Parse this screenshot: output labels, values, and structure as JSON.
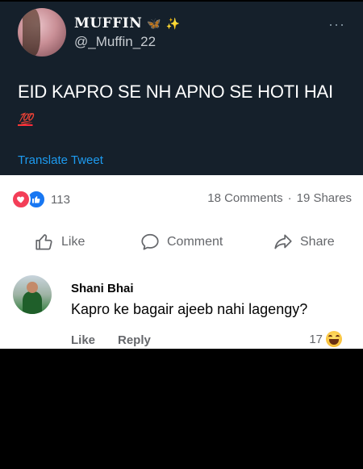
{
  "tweet": {
    "display_name": "MUFFIN",
    "name_emojis": [
      "🦋",
      "✨"
    ],
    "handle": "@_Muffin_22",
    "text": "EID KAPRO SE NH APNO SE HOTI HAI",
    "text_emoji": "💯",
    "translate_label": "Translate Tweet",
    "more_icon": "more-dots-icon"
  },
  "post": {
    "reaction_icons": [
      "love-icon",
      "like-icon"
    ],
    "reaction_count": "113",
    "comments": "18 Comments",
    "separator": "·",
    "shares": "19 Shares"
  },
  "actions": {
    "like": "Like",
    "comment": "Comment",
    "share": "Share"
  },
  "comment": {
    "author": "Shani Bhai",
    "text": "Kapro ke bagair ajeeb nahi lagengy?",
    "like_label": "Like",
    "reply_label": "Reply",
    "reaction_count": "17",
    "reaction_icon": "haha-icon"
  },
  "colors": {
    "tweet_bg": "#15202b",
    "accent_blue": "#1d9bf0",
    "fb_blue": "#1877f2",
    "love_red": "#f33e58",
    "muted_text": "#65676b"
  }
}
